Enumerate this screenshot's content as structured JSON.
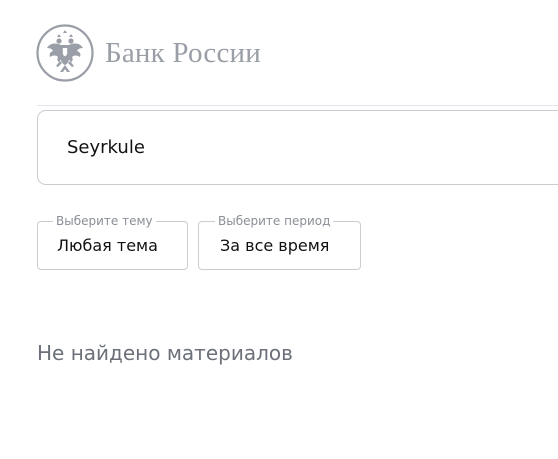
{
  "header": {
    "logo_text": "Банк России",
    "logo_icon": "double-headed-eagle-emblem",
    "logo_color": "#9a9ea6"
  },
  "search": {
    "value": "Seyrkule",
    "placeholder": ""
  },
  "filters": {
    "theme": {
      "legend": "Выберите тему",
      "value": "Любая тема"
    },
    "period": {
      "legend": "Выберите период",
      "value": "За все время"
    }
  },
  "results": {
    "empty_message": "Не найдено материалов"
  },
  "colors": {
    "border": "#c9ccd1",
    "muted_text": "#6b7079",
    "legend_text": "#8a8e96"
  }
}
